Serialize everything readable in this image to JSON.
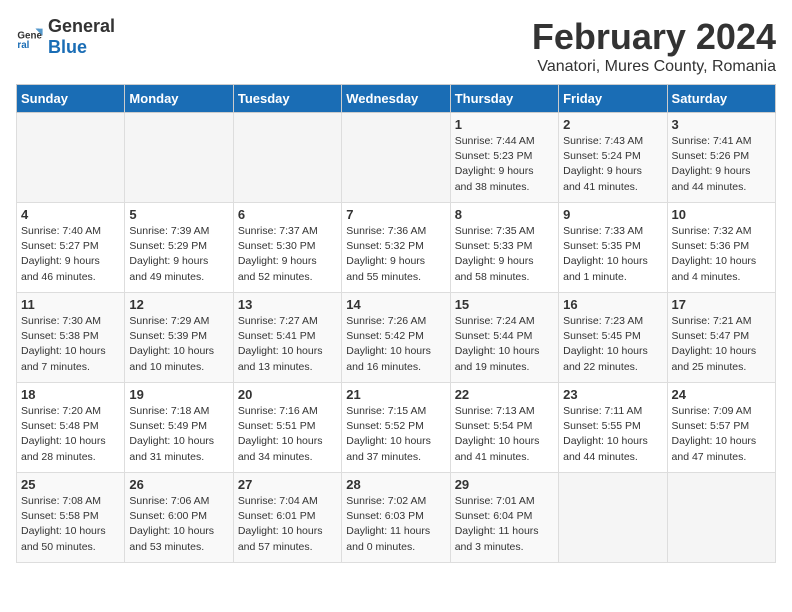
{
  "logo": {
    "general": "General",
    "blue": "Blue"
  },
  "title": "February 2024",
  "subtitle": "Vanatori, Mures County, Romania",
  "days_of_week": [
    "Sunday",
    "Monday",
    "Tuesday",
    "Wednesday",
    "Thursday",
    "Friday",
    "Saturday"
  ],
  "weeks": [
    [
      {
        "day": "",
        "info": ""
      },
      {
        "day": "",
        "info": ""
      },
      {
        "day": "",
        "info": ""
      },
      {
        "day": "",
        "info": ""
      },
      {
        "day": "1",
        "info": "Sunrise: 7:44 AM\nSunset: 5:23 PM\nDaylight: 9 hours\nand 38 minutes."
      },
      {
        "day": "2",
        "info": "Sunrise: 7:43 AM\nSunset: 5:24 PM\nDaylight: 9 hours\nand 41 minutes."
      },
      {
        "day": "3",
        "info": "Sunrise: 7:41 AM\nSunset: 5:26 PM\nDaylight: 9 hours\nand 44 minutes."
      }
    ],
    [
      {
        "day": "4",
        "info": "Sunrise: 7:40 AM\nSunset: 5:27 PM\nDaylight: 9 hours\nand 46 minutes."
      },
      {
        "day": "5",
        "info": "Sunrise: 7:39 AM\nSunset: 5:29 PM\nDaylight: 9 hours\nand 49 minutes."
      },
      {
        "day": "6",
        "info": "Sunrise: 7:37 AM\nSunset: 5:30 PM\nDaylight: 9 hours\nand 52 minutes."
      },
      {
        "day": "7",
        "info": "Sunrise: 7:36 AM\nSunset: 5:32 PM\nDaylight: 9 hours\nand 55 minutes."
      },
      {
        "day": "8",
        "info": "Sunrise: 7:35 AM\nSunset: 5:33 PM\nDaylight: 9 hours\nand 58 minutes."
      },
      {
        "day": "9",
        "info": "Sunrise: 7:33 AM\nSunset: 5:35 PM\nDaylight: 10 hours\nand 1 minute."
      },
      {
        "day": "10",
        "info": "Sunrise: 7:32 AM\nSunset: 5:36 PM\nDaylight: 10 hours\nand 4 minutes."
      }
    ],
    [
      {
        "day": "11",
        "info": "Sunrise: 7:30 AM\nSunset: 5:38 PM\nDaylight: 10 hours\nand 7 minutes."
      },
      {
        "day": "12",
        "info": "Sunrise: 7:29 AM\nSunset: 5:39 PM\nDaylight: 10 hours\nand 10 minutes."
      },
      {
        "day": "13",
        "info": "Sunrise: 7:27 AM\nSunset: 5:41 PM\nDaylight: 10 hours\nand 13 minutes."
      },
      {
        "day": "14",
        "info": "Sunrise: 7:26 AM\nSunset: 5:42 PM\nDaylight: 10 hours\nand 16 minutes."
      },
      {
        "day": "15",
        "info": "Sunrise: 7:24 AM\nSunset: 5:44 PM\nDaylight: 10 hours\nand 19 minutes."
      },
      {
        "day": "16",
        "info": "Sunrise: 7:23 AM\nSunset: 5:45 PM\nDaylight: 10 hours\nand 22 minutes."
      },
      {
        "day": "17",
        "info": "Sunrise: 7:21 AM\nSunset: 5:47 PM\nDaylight: 10 hours\nand 25 minutes."
      }
    ],
    [
      {
        "day": "18",
        "info": "Sunrise: 7:20 AM\nSunset: 5:48 PM\nDaylight: 10 hours\nand 28 minutes."
      },
      {
        "day": "19",
        "info": "Sunrise: 7:18 AM\nSunset: 5:49 PM\nDaylight: 10 hours\nand 31 minutes."
      },
      {
        "day": "20",
        "info": "Sunrise: 7:16 AM\nSunset: 5:51 PM\nDaylight: 10 hours\nand 34 minutes."
      },
      {
        "day": "21",
        "info": "Sunrise: 7:15 AM\nSunset: 5:52 PM\nDaylight: 10 hours\nand 37 minutes."
      },
      {
        "day": "22",
        "info": "Sunrise: 7:13 AM\nSunset: 5:54 PM\nDaylight: 10 hours\nand 41 minutes."
      },
      {
        "day": "23",
        "info": "Sunrise: 7:11 AM\nSunset: 5:55 PM\nDaylight: 10 hours\nand 44 minutes."
      },
      {
        "day": "24",
        "info": "Sunrise: 7:09 AM\nSunset: 5:57 PM\nDaylight: 10 hours\nand 47 minutes."
      }
    ],
    [
      {
        "day": "25",
        "info": "Sunrise: 7:08 AM\nSunset: 5:58 PM\nDaylight: 10 hours\nand 50 minutes."
      },
      {
        "day": "26",
        "info": "Sunrise: 7:06 AM\nSunset: 6:00 PM\nDaylight: 10 hours\nand 53 minutes."
      },
      {
        "day": "27",
        "info": "Sunrise: 7:04 AM\nSunset: 6:01 PM\nDaylight: 10 hours\nand 57 minutes."
      },
      {
        "day": "28",
        "info": "Sunrise: 7:02 AM\nSunset: 6:03 PM\nDaylight: 11 hours\nand 0 minutes."
      },
      {
        "day": "29",
        "info": "Sunrise: 7:01 AM\nSunset: 6:04 PM\nDaylight: 11 hours\nand 3 minutes."
      },
      {
        "day": "",
        "info": ""
      },
      {
        "day": "",
        "info": ""
      }
    ]
  ]
}
